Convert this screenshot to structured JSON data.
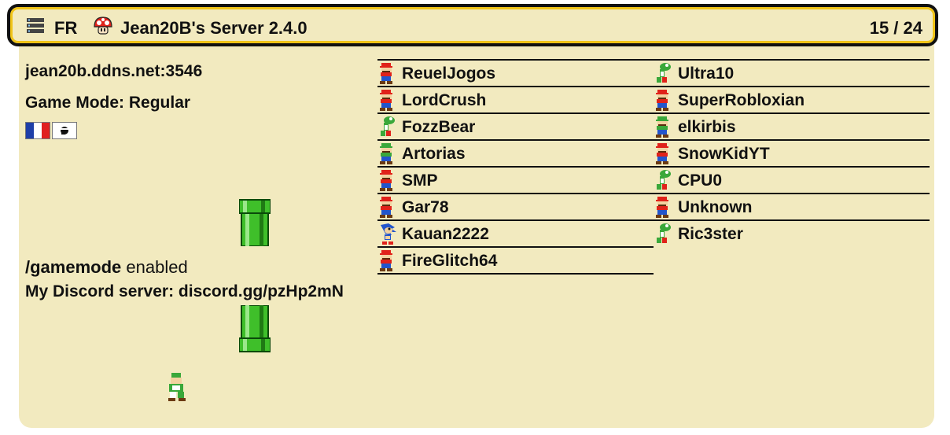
{
  "header": {
    "server_icon": "server-icon",
    "region": "FR",
    "mushroom_icon": "mushroom-icon",
    "title": "Jean20B's Server 2.4.0",
    "player_count": "15 / 24"
  },
  "info": {
    "address": "jean20b.ddns.net:3546",
    "game_mode": "Game Mode: Regular",
    "flags": [
      "france-flag",
      "corsica-flag"
    ],
    "notice_command": "/gamemode",
    "notice_rest": " enabled",
    "discord": "My Discord server: discord.gg/pzHp2mN"
  },
  "players": [
    {
      "name": "ReuelJogos",
      "avatar": "mario-icon"
    },
    {
      "name": "Ultra10",
      "avatar": "yoshi-icon"
    },
    {
      "name": "LordCrush",
      "avatar": "mario-icon"
    },
    {
      "name": "SuperRobloxian",
      "avatar": "mario-icon"
    },
    {
      "name": "FozzBear",
      "avatar": "yoshi-icon"
    },
    {
      "name": "elkirbis",
      "avatar": "luigi-icon"
    },
    {
      "name": "Artorias",
      "avatar": "luigi-icon"
    },
    {
      "name": "SnowKidYT",
      "avatar": "mario-icon"
    },
    {
      "name": "SMP",
      "avatar": "mario-icon"
    },
    {
      "name": "CPU0",
      "avatar": "yoshi-icon"
    },
    {
      "name": "Gar78",
      "avatar": "mario-icon"
    },
    {
      "name": "Unknown",
      "avatar": "mario-icon"
    },
    {
      "name": "Kauan2222",
      "avatar": "sonic-icon"
    },
    {
      "name": "Ric3ster",
      "avatar": "yoshi-icon"
    },
    {
      "name": "FireGlitch64",
      "avatar": "mario-icon"
    }
  ],
  "colors": {
    "panel": "#f2eabf",
    "header_border": "#f0c418",
    "pipe_green": "#3fbf2a",
    "mario_red": "#e0221a",
    "luigi_green": "#3aa83a",
    "sonic_blue": "#2255cc"
  }
}
